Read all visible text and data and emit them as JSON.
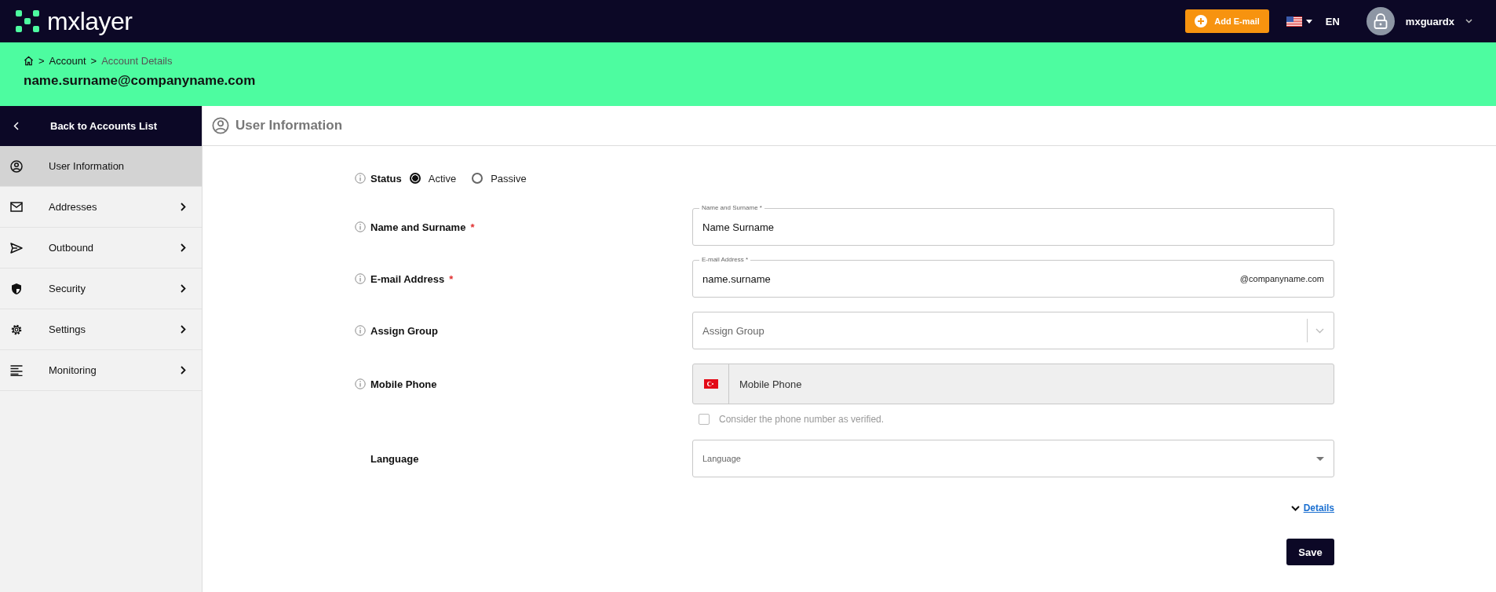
{
  "topbar": {
    "logo": "mxlayer",
    "add_button": "Add E-mail",
    "language": "EN",
    "user": "mxguardx"
  },
  "breadcrumb": [
    {
      "separator": ">",
      "label": "Account",
      "current": false
    },
    {
      "separator": ">",
      "label": "Account Details",
      "current": true
    }
  ],
  "page_title": "name.surname@companyname.com",
  "sidebar": {
    "back": "Back to Accounts List",
    "items": [
      {
        "label": "User Information",
        "selected": true,
        "has_submenu": false
      },
      {
        "label": "Addresses",
        "selected": false,
        "has_submenu": true
      },
      {
        "label": "Outbound",
        "selected": false,
        "has_submenu": true
      },
      {
        "label": "Security",
        "selected": false,
        "has_submenu": true
      },
      {
        "label": "Settings",
        "selected": false,
        "has_submenu": true
      },
      {
        "label": "Monitoring",
        "selected": false,
        "has_submenu": true
      }
    ]
  },
  "section_title": "User Information",
  "form": {
    "rows": [
      {
        "kind": "radio",
        "label": "Status",
        "info": true,
        "options": [
          {
            "label": "Active",
            "selected": true
          },
          {
            "label": "Passive",
            "selected": false
          }
        ]
      },
      {
        "kind": "text",
        "label": "Name and Surname",
        "info": true,
        "required_mark": "*",
        "floating_label": "Name and Surname *",
        "value": "Name Surname"
      },
      {
        "kind": "email",
        "label": "E-mail Address",
        "info": true,
        "required_mark": "*",
        "floating_label": "E-mail Address *",
        "value": "name.surname",
        "suffix": "@companyname.com"
      },
      {
        "kind": "group",
        "label": "Assign Group",
        "info": true,
        "placeholder": "Assign Group"
      },
      {
        "kind": "phone",
        "label": "Mobile Phone",
        "info": true,
        "placeholder": "Mobile Phone",
        "disabled": true,
        "verified_label": "Consider the phone number as verified.",
        "verified_checked": false
      },
      {
        "kind": "select",
        "label": "Language",
        "info": false,
        "placeholder": "Language"
      }
    ],
    "details_link": "Details",
    "save_button": "Save"
  }
}
